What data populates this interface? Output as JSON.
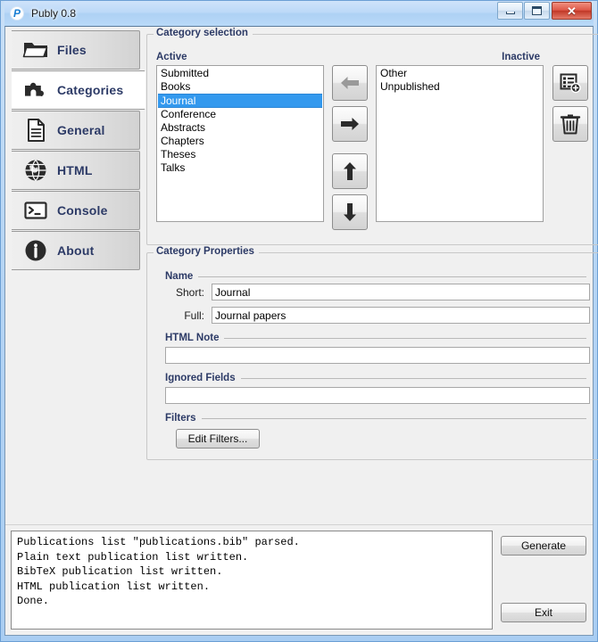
{
  "window": {
    "title": "Publy 0.8",
    "app_icon": "publy-p-icon",
    "buttons": {
      "minimize": "minimize-icon",
      "maximize": "maximize-icon",
      "close": "✕"
    }
  },
  "sidebar": {
    "items": [
      {
        "label": "Files",
        "icon": "folder-icon",
        "active": false
      },
      {
        "label": "Categories",
        "icon": "puzzle-icon",
        "active": true
      },
      {
        "label": "General",
        "icon": "document-icon",
        "active": false
      },
      {
        "label": "HTML",
        "icon": "globe-icon",
        "active": false
      },
      {
        "label": "Console",
        "icon": "terminal-icon",
        "active": false
      },
      {
        "label": "About",
        "icon": "info-icon",
        "active": false
      }
    ]
  },
  "category_selection": {
    "group_title": "Category selection",
    "active_label": "Active",
    "inactive_label": "Inactive",
    "active_items": [
      "Submitted",
      "Books",
      "Journal",
      "Conference",
      "Abstracts",
      "Chapters",
      "Theses",
      "Talks"
    ],
    "selected_active": "Journal",
    "inactive_items": [
      "Other",
      "Unpublished"
    ],
    "transfer_buttons": [
      {
        "name": "move-left-button",
        "icon": "arrow-left-icon",
        "enabled": false
      },
      {
        "name": "move-right-button",
        "icon": "arrow-right-icon",
        "enabled": true
      },
      {
        "name": "move-up-button",
        "icon": "arrow-up-icon",
        "enabled": true
      },
      {
        "name": "move-down-button",
        "icon": "arrow-down-icon",
        "enabled": true
      }
    ],
    "side_buttons": [
      {
        "name": "add-category-button",
        "icon": "list-add-icon"
      },
      {
        "name": "delete-category-button",
        "icon": "trash-icon"
      }
    ]
  },
  "category_properties": {
    "group_title": "Category Properties",
    "name_group": "Name",
    "short_label": "Short:",
    "short_value": "Journal",
    "full_label": "Full:",
    "full_value": "Journal papers",
    "html_note_group": "HTML Note",
    "html_note_value": "",
    "ignored_fields_group": "Ignored Fields",
    "ignored_fields_value": "",
    "filters_group": "Filters",
    "edit_filters_label": "Edit Filters..."
  },
  "console": {
    "lines": [
      "Publications list \"publications.bib\" parsed.",
      "Plain text publication list written.",
      "BibTeX publication list written.",
      "HTML publication list written.",
      "Done."
    ]
  },
  "actions": {
    "generate_label": "Generate",
    "exit_label": "Exit"
  },
  "colors": {
    "selection_blue": "#3399ee",
    "label_navy": "#2c3a66",
    "panel_gray": "#f0f0f0",
    "title_blue": "#b6d5f4",
    "close_red": "#c03726"
  }
}
